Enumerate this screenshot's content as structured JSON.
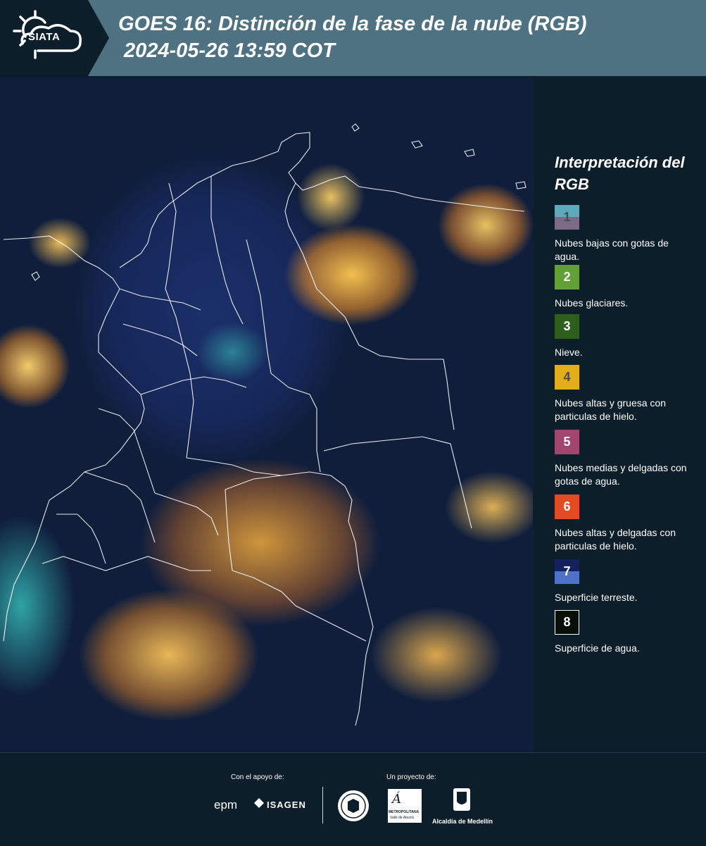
{
  "header": {
    "logo_text": "SIATA",
    "title_line1": "GOES 16: Distinción de la fase de la nube (RGB)",
    "title_line2": "2024-05-26 13:59 COT"
  },
  "colors": {
    "header_bg": "#4e7282",
    "page_bg": "#0c1e2a",
    "boundary_line": "#ffffff"
  },
  "legend": {
    "title": "Interpretación del RGB",
    "items": [
      {
        "number": "1",
        "label": "Nubes bajas con gotas de agua.",
        "color_top": "#5fa9bc",
        "color_bottom": "#7d6a86"
      },
      {
        "number": "2",
        "label": "Nubes glaciares.",
        "color": "#63a037"
      },
      {
        "number": "3",
        "label": "Nieve.",
        "color": "#2f5f1d"
      },
      {
        "number": "4",
        "label": "Nubes altas y gruesa con particulas de hielo.",
        "color": "#e3ad1b"
      },
      {
        "number": "5",
        "label": "Nubes medias y delgadas con gotas de agua.",
        "color": "#a3466f"
      },
      {
        "number": "6",
        "label": "Nubes altas y delgadas con particulas de hielo.",
        "color": "#e24c24"
      },
      {
        "number": "7",
        "label": "Superficie terreste.",
        "color_top": "#13215e",
        "color_bottom": "#4e72c8"
      },
      {
        "number": "8",
        "label": "Superficie de agua.",
        "color": "#071008"
      }
    ]
  },
  "footer": {
    "support_label": "Con el apoyo de:",
    "project_label": "Un proyecto de:",
    "epm": "epm",
    "isagen": "ISAGEN",
    "area_metropolitana": "METROPOLITANA",
    "area_sub": "Valle de Aburrá",
    "alcaldia": "Alcaldía de Medellín"
  }
}
